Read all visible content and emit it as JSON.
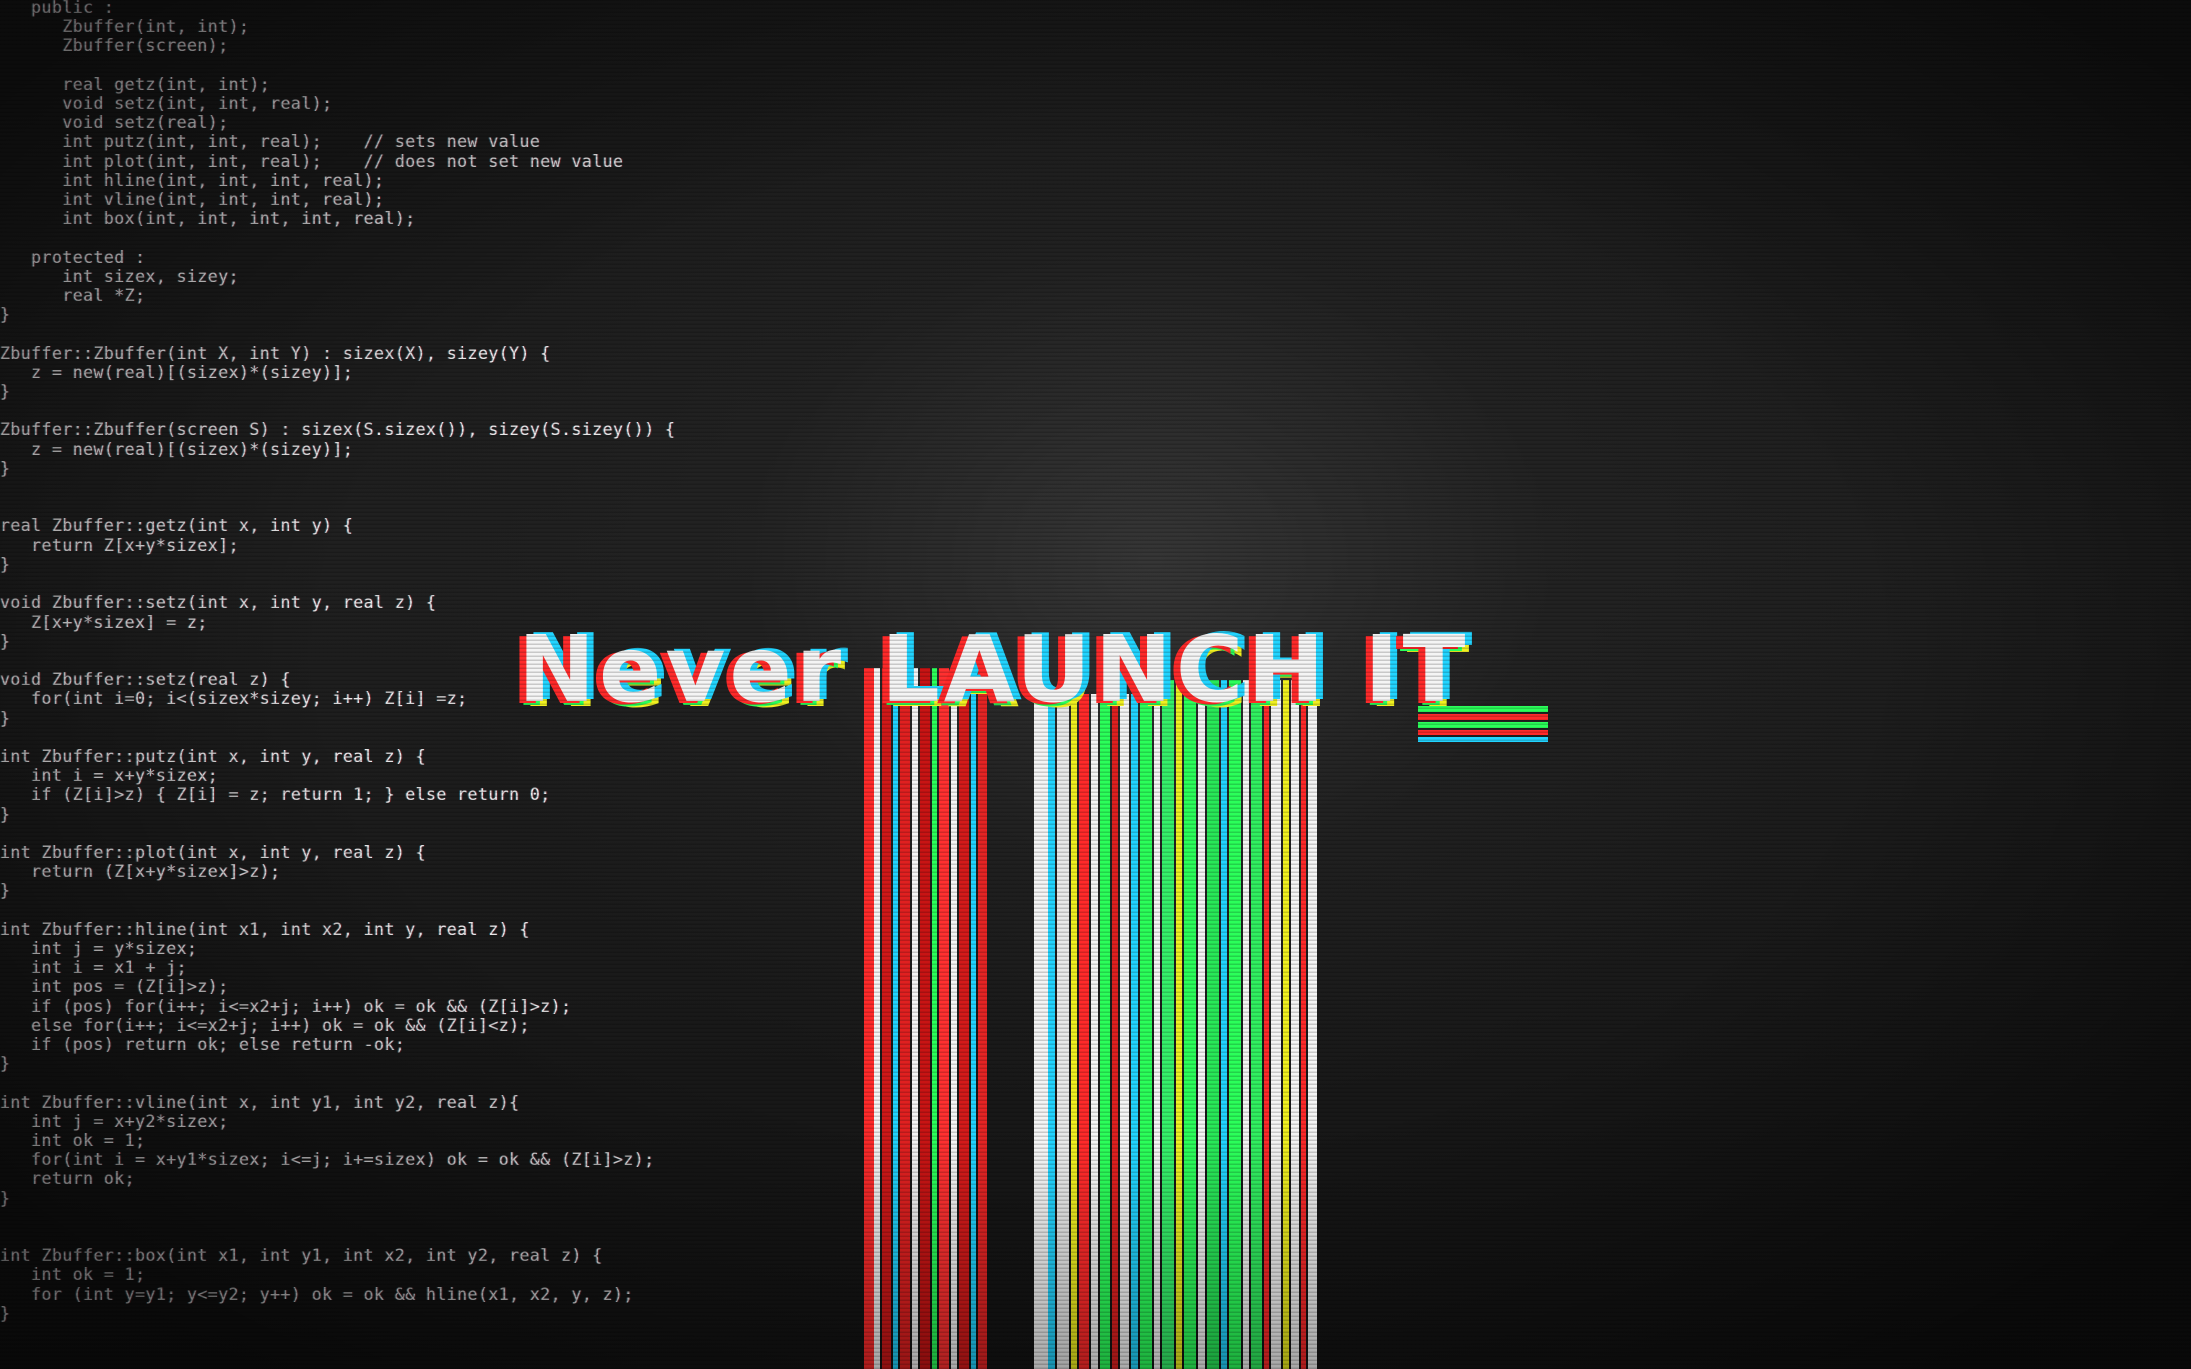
{
  "code_listing": "   public :\n      Zbuffer(int, int);\n      Zbuffer(screen);\n\n      real getz(int, int);\n      void setz(int, int, real);\n      void setz(real);\n      int putz(int, int, real);    // sets new value\n      int plot(int, int, real);    // does not set new value\n      int hline(int, int, int, real);\n      int vline(int, int, int, real);\n      int box(int, int, int, int, real);\n\n   protected :\n      int sizex, sizey;\n      real *Z;\n}\n\nZbuffer::Zbuffer(int X, int Y) : sizex(X), sizey(Y) {\n   z = new(real)[(sizex)*(sizey)];\n}\n\nZbuffer::Zbuffer(screen S) : sizex(S.sizex()), sizey(S.sizey()) {\n   z = new(real)[(sizex)*(sizey)];\n}\n\n\nreal Zbuffer::getz(int x, int y) {\n   return Z[x+y*sizex];\n}\n\nvoid Zbuffer::setz(int x, int y, real z) {\n   Z[x+y*sizex] = z;\n}\n\nvoid Zbuffer::setz(real z) {\n   for(int i=0; i<(sizex*sizey; i++) Z[i] =z;\n}\n\nint Zbuffer::putz(int x, int y, real z) {\n   int i = x+y*sizex;\n   if (Z[i]>z) { Z[i] = z; return 1; } else return 0;\n}\n\nint Zbuffer::plot(int x, int y, real z) {\n   return (Z[x+y*sizex]>z);\n}\n\nint Zbuffer::hline(int x1, int x2, int y, real z) {\n   int j = y*sizex;\n   int i = x1 + j;\n   int pos = (Z[i]>z);\n   if (pos) for(i++; i<=x2+j; i++) ok = ok && (Z[i]>z);\n   else for(i++; i<=x2+j; i++) ok = ok && (Z[i]<z);\n   if (pos) return ok; else return -ok;\n}\n\nint Zbuffer::vline(int x, int y1, int y2, real z){\n   int j = x+y2*sizex;\n   int ok = 1;\n   for(int i = x+y1*sizex; i<=j; i+=sizex) ok = ok && (Z[i]>z);\n   return ok;\n}\n\n\nint Zbuffer::box(int x1, int y1, int x2, int y2, real z) {\n   int ok = 1;\n   for (int y=y1; y<=y2; y++) ok = ok && hline(x1, x2, y, z);\n}",
  "headline": "Never LAUNCH IT",
  "colors": {
    "background": "#1c1c1c",
    "code_text": "#e8e8e8",
    "glitch_red": "#ff2a2a",
    "glitch_cyan": "#22d4ff",
    "glitch_green": "#2bff5a",
    "glitch_yellow": "#f0f020",
    "glitch_white": "#f4f4f4"
  }
}
